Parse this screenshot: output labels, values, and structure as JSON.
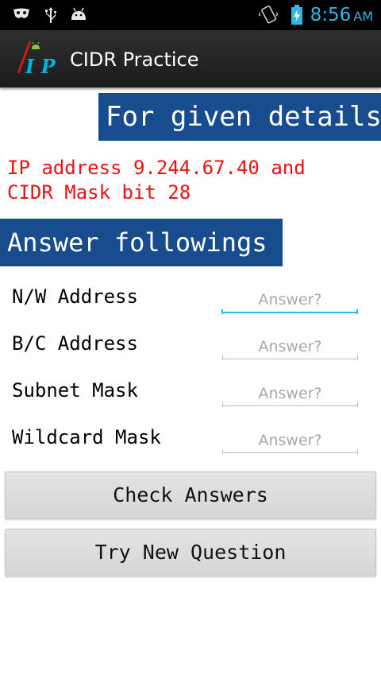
{
  "status_bar": {
    "time": "8:56",
    "ampm": "AM",
    "icons": [
      "privacy-mask-icon",
      "usb-icon",
      "android-debug-icon",
      "vibrate-icon",
      "battery-charging-icon"
    ],
    "accent_color": "#33b5e5"
  },
  "action_bar": {
    "title": "CIDR Practice",
    "logo_icon": "ip-logo-icon"
  },
  "given": {
    "banner": "For given details",
    "question_line1": "IP address 9.244.67.40 and",
    "question_line2": "CIDR Mask bit 28",
    "question_color": "#ee1111"
  },
  "answer": {
    "banner": "Answer followings",
    "banner_color": "#174c8f",
    "rows": [
      {
        "label": "N/W Address",
        "placeholder": "Answer?",
        "value": ""
      },
      {
        "label": "B/C Address",
        "placeholder": "Answer?",
        "value": ""
      },
      {
        "label": "Subnet Mask",
        "placeholder": "Answer?",
        "value": ""
      },
      {
        "label": "Wildcard Mask",
        "placeholder": "Answer?",
        "value": ""
      }
    ]
  },
  "buttons": {
    "check": "Check Answers",
    "new_question": "Try New Question"
  }
}
